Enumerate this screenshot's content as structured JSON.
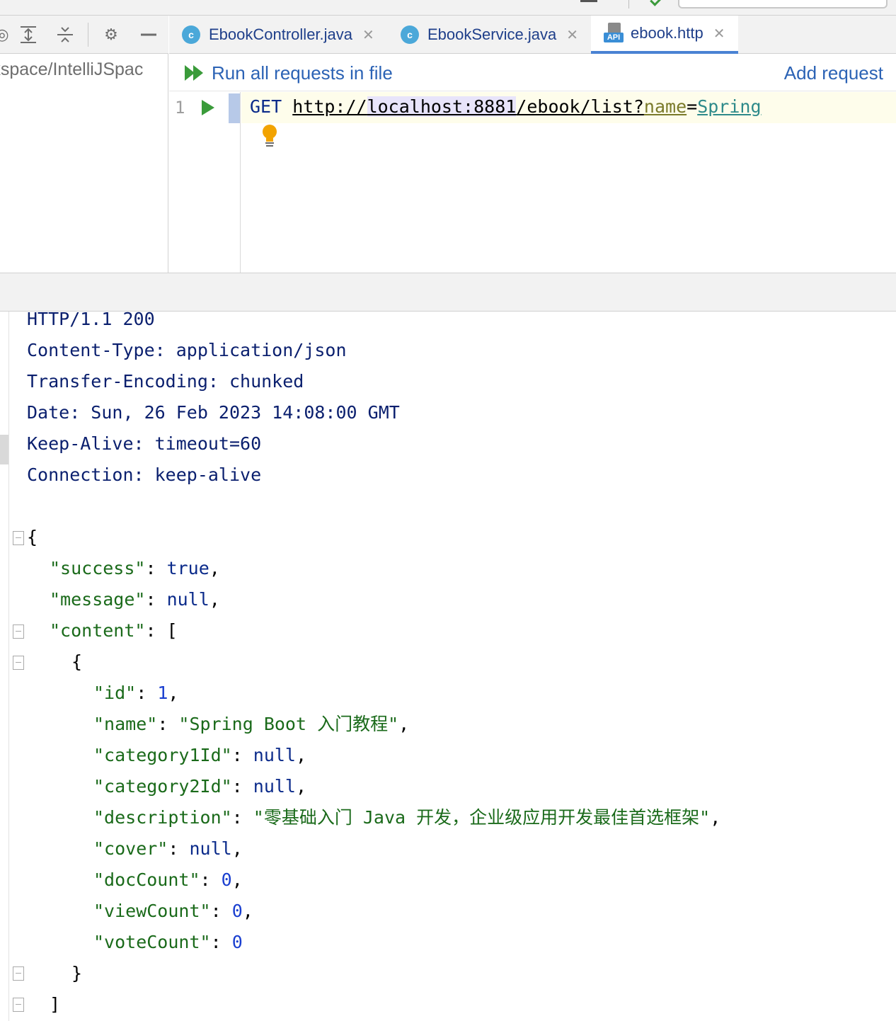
{
  "left_panel": {
    "path": "rkspace/IntelliJSpac",
    "toolbar_icons": [
      "locate-icon",
      "expand-all-icon",
      "collapse-all-icon",
      "gear-icon",
      "minimize-icon"
    ]
  },
  "tabs": [
    {
      "label": "EbookController.java",
      "icon": "c",
      "active": false
    },
    {
      "label": "EbookService.java",
      "icon": "c",
      "active": false
    },
    {
      "label": "ebook.http",
      "icon": "API",
      "active": true
    }
  ],
  "http_toolbar": {
    "run_all_label": "Run all requests in file",
    "add_request_label": "Add request"
  },
  "editor": {
    "line_number": "1",
    "method": "GET",
    "url_scheme": "http://",
    "url_host": "localhost:8881",
    "url_path": "/ebook/list?",
    "query_name": "name",
    "query_eq": "=",
    "query_value": "Spring"
  },
  "response": {
    "status": "HTTP/1.1 200",
    "headers": [
      "Content-Type: application/json",
      "Transfer-Encoding: chunked",
      "Date: Sun, 26 Feb 2023 14:08:00 GMT",
      "Keep-Alive: timeout=60",
      "Connection: keep-alive"
    ],
    "body": {
      "open_brace": "{",
      "success_key": "\"success\"",
      "success_val": "true",
      "message_key": "\"message\"",
      "message_val": "null",
      "content_key": "\"content\"",
      "content_open": "[",
      "item_open": "{",
      "id_key": "\"id\"",
      "id_val": "1",
      "name_key": "\"name\"",
      "name_val": "\"Spring Boot 入门教程\"",
      "c1_key": "\"category1Id\"",
      "c1_val": "null",
      "c2_key": "\"category2Id\"",
      "c2_val": "null",
      "desc_key": "\"description\"",
      "desc_val": "\"零基础入门 Java 开发，企业级应用开发最佳首选框架\"",
      "cover_key": "\"cover\"",
      "cover_val": "null",
      "doc_key": "\"docCount\"",
      "doc_val": "0",
      "view_key": "\"viewCount\"",
      "view_val": "0",
      "vote_key": "\"voteCount\"",
      "vote_val": "0",
      "item_close": "}",
      "content_close": "]"
    }
  },
  "colors": {
    "link_blue": "#2c63b5",
    "run_green": "#3a9b3a",
    "json_key_green": "#1a6a1a",
    "number_blue": "#1a3fd0",
    "header_navy": "#0a1f6e"
  }
}
